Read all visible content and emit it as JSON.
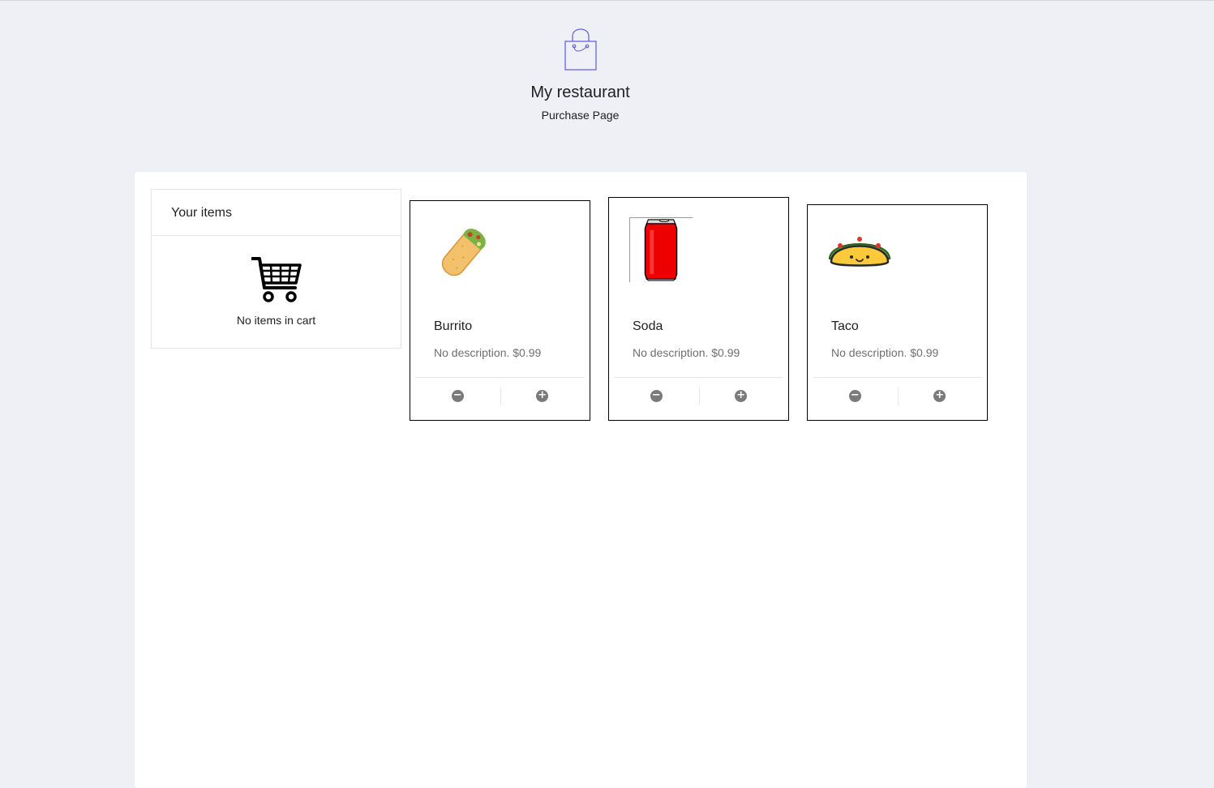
{
  "header": {
    "logo_icon": "shopping-bag-icon",
    "title": "My restaurant",
    "subtitle": "Purchase Page"
  },
  "cart": {
    "heading": "Your items",
    "empty_icon": "shopping-cart-icon",
    "empty_text": "No items in cart"
  },
  "products": [
    {
      "name": "Burrito",
      "description": "No description. $0.99",
      "image_icon": "burrito-icon",
      "decrement_icon": "minus-icon",
      "increment_icon": "plus-icon"
    },
    {
      "name": "Soda",
      "description": "No description. $0.99",
      "image_icon": "soda-can-icon",
      "decrement_icon": "minus-icon",
      "increment_icon": "plus-icon"
    },
    {
      "name": "Taco",
      "description": "No description. $0.99",
      "image_icon": "taco-icon",
      "decrement_icon": "minus-icon",
      "increment_icon": "plus-icon"
    }
  ],
  "colors": {
    "page_background": "#eff0f5",
    "panel_background": "#ffffff",
    "logo_accent": "#6b63d6",
    "muted_text": "#6f6f6f",
    "button_gray": "#7a7a7a"
  }
}
